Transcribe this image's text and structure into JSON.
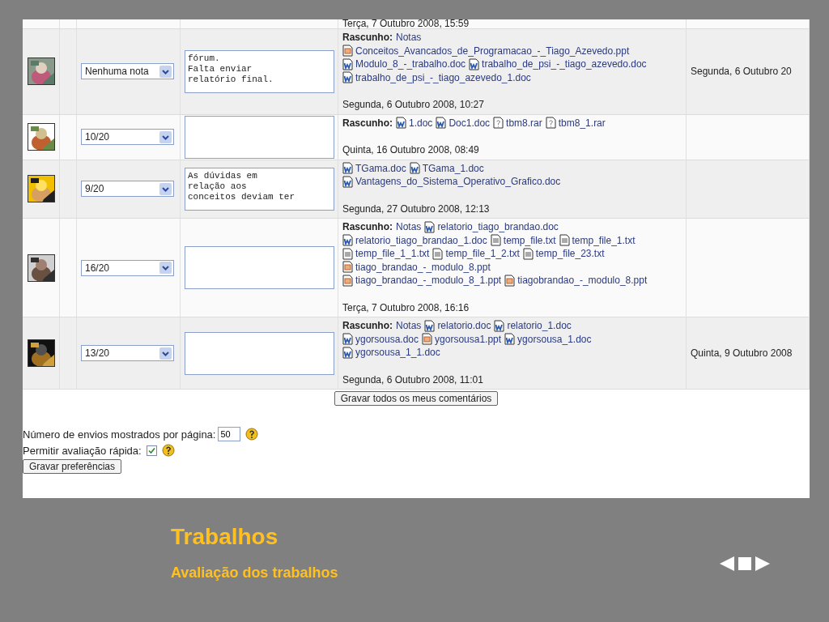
{
  "table": {
    "top_row": {
      "submitted": "Terça, 7 Outubro 2008, 15:59"
    },
    "rows": [
      {
        "grade": "Nenhuma nota",
        "comment": "fórum.\nFalta enviar\nrelatório final.",
        "draft_label": "Rascunho:",
        "notes_link": "Notas",
        "files": [
          {
            "name": "Conceitos_Avancados_de_Programacao_-_Tiago_Azevedo.ppt",
            "kind": "ppt"
          },
          {
            "name": "Modulo_8_-_trabalho.doc",
            "kind": "doc"
          },
          {
            "name": "trabalho_de_psi_-_tiago_azevedo.doc",
            "kind": "doc"
          },
          {
            "name": "trabalho_de_psi_-_tiago_azevedo_1.doc",
            "kind": "doc"
          }
        ],
        "submitted": "Segunda, 6 Outubro 2008, 10:27",
        "graded": "Segunda, 6 Outubro 20"
      },
      {
        "grade": "10/20",
        "draft_label": "Rascunho:",
        "files": [
          {
            "name": "1.doc",
            "kind": "doc"
          },
          {
            "name": "Doc1.doc",
            "kind": "doc"
          },
          {
            "name": "tbm8.rar",
            "kind": "unknown"
          },
          {
            "name": "tbm8_1.rar",
            "kind": "unknown"
          }
        ],
        "submitted": "Quinta, 16 Outubro 2008, 08:49"
      },
      {
        "grade": "9/20",
        "comment": "As dúvidas em\nrelação aos\nconceitos deviam ter",
        "files": [
          {
            "name": "TGama.doc",
            "kind": "doc"
          },
          {
            "name": "TGama_1.doc",
            "kind": "doc"
          },
          {
            "name": "Vantagens_do_Sistema_Operativo_Grafico.doc",
            "kind": "doc"
          }
        ],
        "submitted": "Segunda, 27 Outubro 2008, 12:13"
      },
      {
        "grade": "16/20",
        "draft_label": "Rascunho:",
        "notes_link": "Notas",
        "files": [
          {
            "name": "relatorio_tiago_brandao.doc",
            "kind": "doc"
          },
          {
            "name": "relatorio_tiago_brandao_1.doc",
            "kind": "doc"
          },
          {
            "name": "temp_file.txt",
            "kind": "txt"
          },
          {
            "name": "temp_file_1.txt",
            "kind": "txt"
          },
          {
            "name": "temp_file_1_1.txt",
            "kind": "txt"
          },
          {
            "name": "temp_file_1_2.txt",
            "kind": "txt"
          },
          {
            "name": "temp_file_23.txt",
            "kind": "txt"
          },
          {
            "name": "tiago_brandao_-_modulo_8.ppt",
            "kind": "ppt"
          },
          {
            "name": "tiago_brandao_-_modulo_8_1.ppt",
            "kind": "ppt"
          },
          {
            "name": "tiagobrandao_-_modulo_8.ppt",
            "kind": "ppt"
          }
        ],
        "submitted": "Terça, 7 Outubro 2008, 16:16"
      },
      {
        "grade": "13/20",
        "draft_label": "Rascunho:",
        "notes_link": "Notas",
        "files": [
          {
            "name": "relatorio.doc",
            "kind": "doc"
          },
          {
            "name": "relatorio_1.doc",
            "kind": "doc"
          },
          {
            "name": "ygorsousa.doc",
            "kind": "doc"
          },
          {
            "name": "ygorsousa1.ppt",
            "kind": "ppt"
          },
          {
            "name": "ygorsousa_1.doc",
            "kind": "doc"
          },
          {
            "name": "ygorsousa_1_1.doc",
            "kind": "doc"
          }
        ],
        "submitted": "Segunda, 6 Outubro 2008, 11:01",
        "graded": "Quinta, 9 Outubro 2008"
      }
    ]
  },
  "save_all_button": "Gravar todos os meus comentários",
  "preferences": {
    "per_page_label": "Número de envios mostrados por página:",
    "per_page_value": "50",
    "quick_grading_label": "Permitir avaliação rápida:",
    "quick_grading_checked": true,
    "save_button": "Gravar preferências"
  },
  "slide": {
    "title": "Trabalhos",
    "subtitle": "Avaliação dos trabalhos"
  }
}
